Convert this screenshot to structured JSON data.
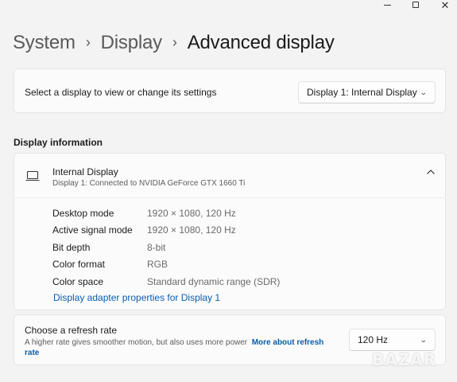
{
  "window": {
    "minimize_glyph": "—",
    "close_glyph": "✕"
  },
  "breadcrumb": {
    "items": [
      "System",
      "Display",
      "Advanced display"
    ],
    "separator": "›"
  },
  "display_select": {
    "label": "Select a display to view or change its settings",
    "selected": "Display 1: Internal Display"
  },
  "display_info": {
    "section_title": "Display information",
    "device_title": "Internal Display",
    "device_subtitle": "Display 1: Connected to NVIDIA GeForce GTX 1660 Ti",
    "expanded": true,
    "rows": [
      {
        "key": "Desktop mode",
        "value": "1920 × 1080, 120 Hz"
      },
      {
        "key": "Active signal mode",
        "value": "1920 × 1080, 120 Hz"
      },
      {
        "key": "Bit depth",
        "value": "8-bit"
      },
      {
        "key": "Color format",
        "value": "RGB"
      },
      {
        "key": "Color space",
        "value": "Standard dynamic range (SDR)"
      }
    ],
    "adapter_link": "Display adapter properties for Display 1"
  },
  "refresh": {
    "title": "Choose a refresh rate",
    "description": "A higher rate gives smoother motion, but also uses more power",
    "more_link": "More about refresh rate",
    "selected": "120 Hz"
  },
  "watermark": "BAZAR",
  "colors": {
    "background": "#f3f3f3",
    "card": "#fbfbfb",
    "link": "#0b5cad"
  },
  "icons": {
    "device": "laptop-icon",
    "expand": "chevron-up-icon",
    "dropdown": "chevron-down-icon"
  }
}
